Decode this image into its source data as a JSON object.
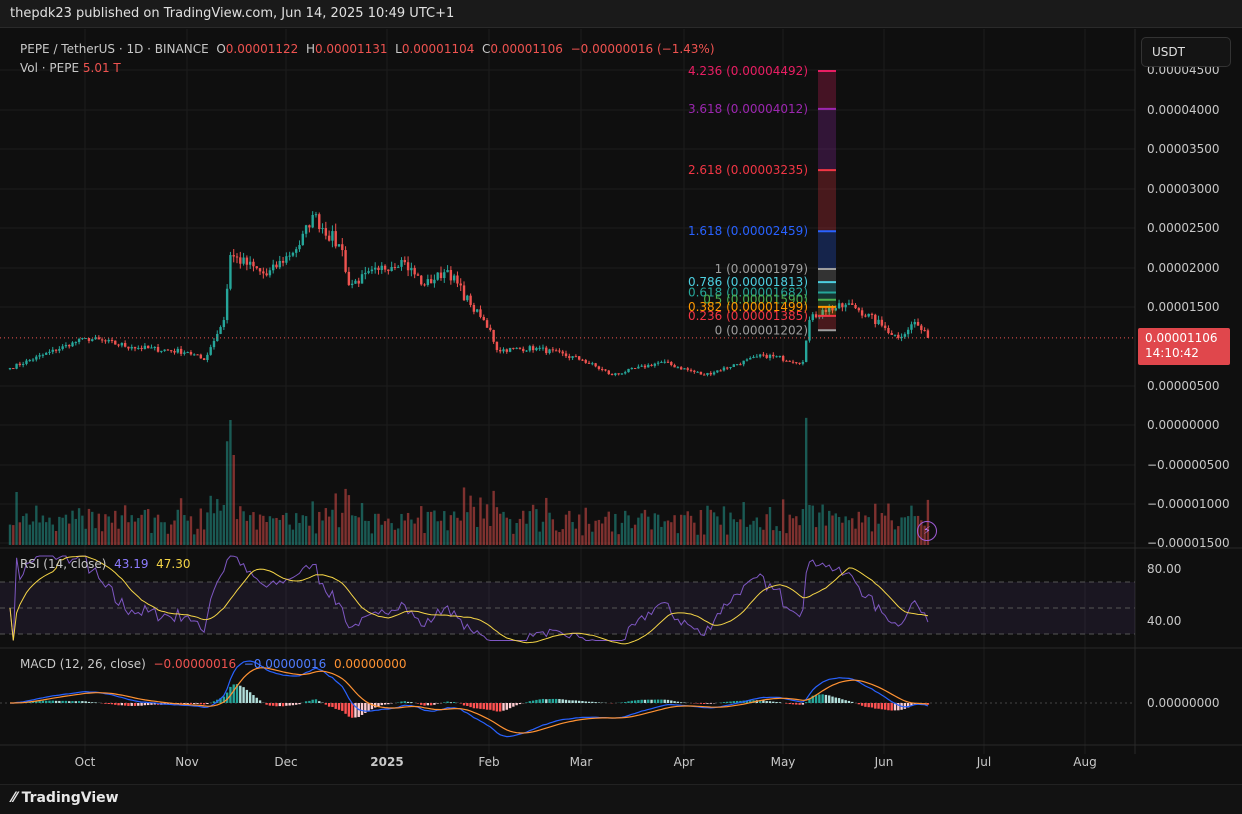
{
  "topbar": {
    "text": "thepdk23 published on TradingView.com, Jun 14, 2025 10:49 UTC+1"
  },
  "legend": {
    "symbol": "PEPE / TetherUS · 1D · BINANCE",
    "o_label": "O",
    "o": "0.00001122",
    "h_label": "H",
    "h": "0.00001131",
    "l_label": "L",
    "l": "0.00001104",
    "c_label": "C",
    "c": "0.00001106",
    "change": "−0.00000016 (−1.43%)",
    "vol_label": "Vol · PEPE",
    "vol": "5.01 T"
  },
  "currency_button": "USDT",
  "price_tag": {
    "price": "0.00001106",
    "countdown": "14:10:42"
  },
  "footer": {
    "logo": "TradingView"
  },
  "colors": {
    "up": "#26a69a",
    "down": "#ef5350",
    "rsi": "#7e57c2",
    "rsi_ma": "#f5d547",
    "macd": "#2962ff",
    "signal": "#ff9233"
  },
  "chart_data": {
    "type": "candlestick",
    "price_unit": "0.00000001 USDT",
    "yaxis_ticks": [
      "0.00004500",
      "0.00004000",
      "0.00003500",
      "0.00003000",
      "0.00002500",
      "0.00002000",
      "0.00001500",
      "0.00000500",
      "0.00000000",
      "−0.00000500",
      "−0.00001000",
      "−0.00001500"
    ],
    "xaxis_ticks": [
      "Oct",
      "Nov",
      "Dec",
      "2025",
      "Feb",
      "Mar",
      "Apr",
      "May",
      "Jun",
      "Jul",
      "Aug"
    ],
    "close_anchors_day_from_sep8": [
      [
        0,
        723
      ],
      [
        23,
        1104
      ],
      [
        37,
        990
      ],
      [
        54,
        926
      ],
      [
        59,
        825
      ],
      [
        65,
        1332
      ],
      [
        67,
        2157
      ],
      [
        78,
        1900
      ],
      [
        88,
        2284
      ],
      [
        92,
        2665
      ],
      [
        101,
        2220
      ],
      [
        103,
        1777
      ],
      [
        112,
        1967
      ],
      [
        119,
        2094
      ],
      [
        126,
        1777
      ],
      [
        133,
        1967
      ],
      [
        140,
        1523
      ],
      [
        146,
        1206
      ],
      [
        148,
        952
      ],
      [
        160,
        977
      ],
      [
        174,
        825
      ],
      [
        183,
        635
      ],
      [
        198,
        800
      ],
      [
        211,
        635
      ],
      [
        229,
        888
      ],
      [
        241,
        800
      ],
      [
        243,
        1332
      ],
      [
        247,
        1459
      ],
      [
        256,
        1523
      ],
      [
        266,
        1231
      ],
      [
        270,
        1104
      ],
      [
        275,
        1307
      ],
      [
        279,
        1106
      ]
    ],
    "fib_levels": [
      {
        "ratio": "4.236",
        "price": "0.00004492",
        "color": "#e91e63"
      },
      {
        "ratio": "3.618",
        "price": "0.00004012",
        "color": "#9c27b0"
      },
      {
        "ratio": "2.618",
        "price": "0.00003235",
        "color": "#f23645"
      },
      {
        "ratio": "1.618",
        "price": "0.00002459",
        "color": "#2962ff"
      },
      {
        "ratio": "1",
        "price": "0.00001979",
        "color": "#9e9e9e"
      },
      {
        "ratio": "0.786",
        "price": "0.00001813",
        "color": "#4dd0e1"
      },
      {
        "ratio": "0.618",
        "price": "0.00001682",
        "color": "#26a69a"
      },
      {
        "ratio": "0.5",
        "price": "0.00001590",
        "color": "#4caf50"
      },
      {
        "ratio": "0.382",
        "price": "0.00001499",
        "color": "#ff9800"
      },
      {
        "ratio": "0.236",
        "price": "0.00001385",
        "color": "#f23645"
      },
      {
        "ratio": "0",
        "price": "0.00001202",
        "color": "#9e9e9e"
      }
    ],
    "rsi": {
      "label": "RSI (14, close)",
      "value": "43.19",
      "ma_value": "47.30",
      "ticks": [
        "80.00",
        "40.00"
      ],
      "bands": [
        70,
        50,
        30
      ]
    },
    "macd": {
      "label": "MACD (12, 26, close)",
      "hist": "−0.00000016",
      "macd": "−0.00000016",
      "signal": "0.00000000",
      "tick": "0.00000000"
    }
  }
}
